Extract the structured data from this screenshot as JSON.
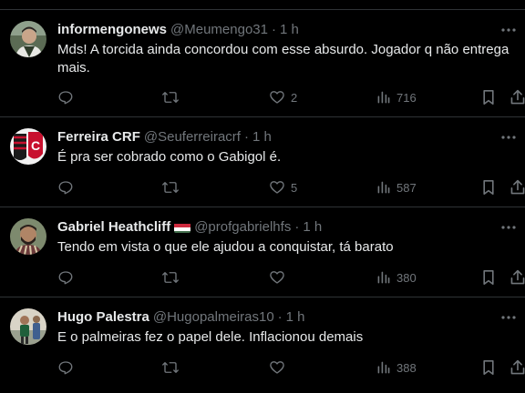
{
  "tweets": [
    {
      "display_name": "informengonews",
      "handle": "@Meumengo31",
      "separator": "·",
      "time": "1 h",
      "text": "Mds! A torcida ainda concordou com esse absurdo. Jogador q não entrega mais.",
      "replies": "",
      "retweets": "",
      "likes": "2",
      "views": "716",
      "avatar_icon": "man-portrait-avatar"
    },
    {
      "display_name": "Ferreira CRF",
      "handle": "@Seuferreiracrf",
      "separator": "·",
      "time": "1 h",
      "text": "É pra ser cobrado como o Gabigol é.",
      "replies": "",
      "retweets": "",
      "likes": "5",
      "views": "587",
      "avatar_icon": "team-crest-avatar"
    },
    {
      "display_name": "Gabriel Heathcliff",
      "flag": "hungary-flag-icon",
      "handle": "@profgabrielhfs",
      "separator": "·",
      "time": "1 h",
      "text": "Tendo em vista o que ele ajudou a conquistar, tá barato",
      "replies": "",
      "retweets": "",
      "likes": "",
      "views": "380",
      "avatar_icon": "bearded-man-avatar"
    },
    {
      "display_name": "Hugo Palestra",
      "handle": "@Hugopalmeiras10",
      "separator": "·",
      "time": "1 h",
      "text": "E o palmeiras fez o papel dele. Inflacionou demais",
      "replies": "",
      "retweets": "",
      "likes": "",
      "views": "388",
      "avatar_icon": "player-photo-avatar"
    }
  ],
  "colors": {
    "background": "#000000",
    "text_primary": "#e7e9ea",
    "text_secondary": "#71767b",
    "divider": "#2f3336"
  }
}
